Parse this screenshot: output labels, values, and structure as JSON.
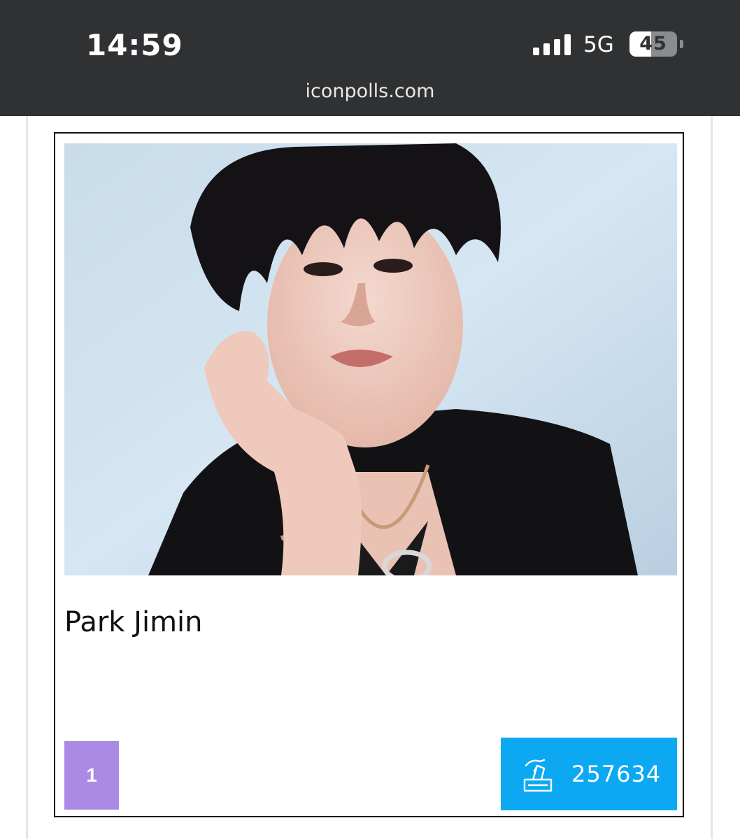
{
  "status_bar": {
    "time": "14:59",
    "network": "5G",
    "battery_level": "45"
  },
  "browser": {
    "url": "iconpolls.com"
  },
  "card": {
    "name": "Park Jimin",
    "rank": "1",
    "votes": "257634",
    "vote_icon": "ballot-box-icon"
  },
  "colors": {
    "rank_badge": "#ab8ae6",
    "vote_button": "#0ca9f2",
    "top_bar": "#2f3133"
  }
}
